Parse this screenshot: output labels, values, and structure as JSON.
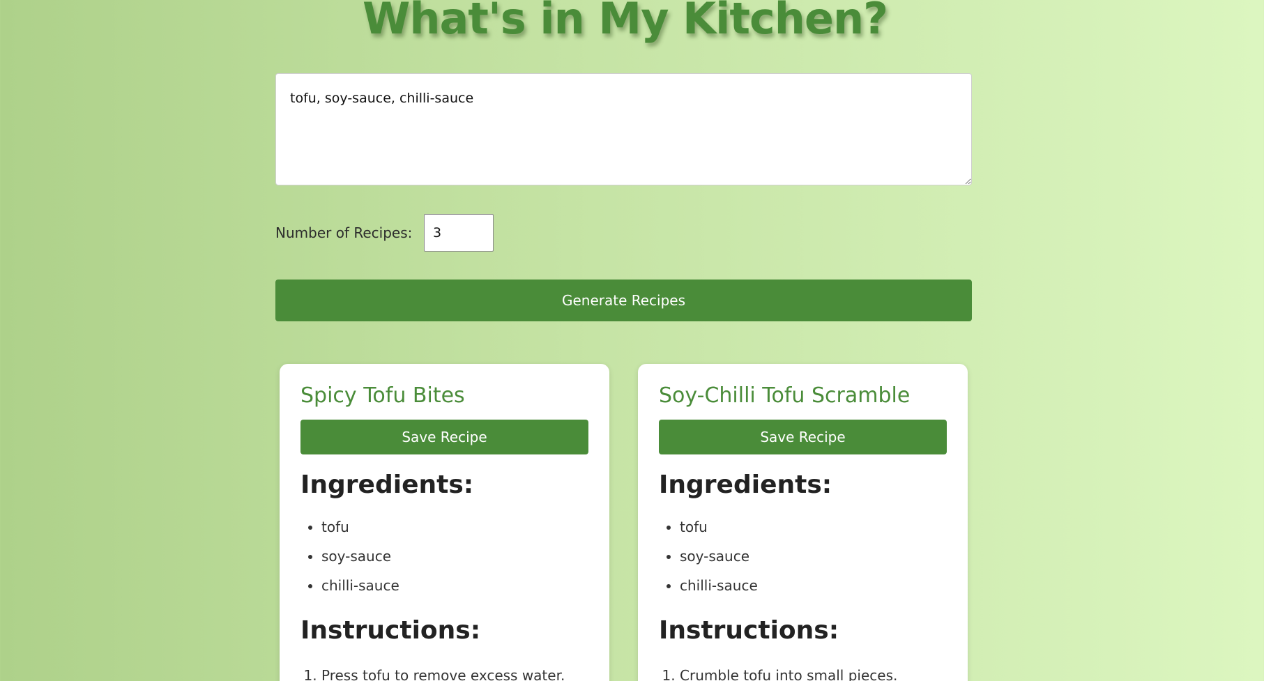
{
  "page": {
    "title": "What's in My Kitchen?"
  },
  "form": {
    "ingredients_value": "tofu, soy-sauce, chilli-sauce",
    "count_label": "Number of Recipes:",
    "count_value": "3",
    "generate_label": "Generate Recipes"
  },
  "recipes": [
    {
      "title": "Spicy Tofu Bites",
      "save_label": "Save Recipe",
      "ingredients_heading": "Ingredients:",
      "ingredients": [
        "tofu",
        "soy-sauce",
        "chilli-sauce"
      ],
      "instructions_heading": "Instructions:",
      "instructions": [
        "Press tofu to remove excess water."
      ]
    },
    {
      "title": "Soy-Chilli Tofu Scramble",
      "save_label": "Save Recipe",
      "ingredients_heading": "Ingredients:",
      "ingredients": [
        "tofu",
        "soy-sauce",
        "chilli-sauce"
      ],
      "instructions_heading": "Instructions:",
      "instructions": [
        "Crumble tofu into small pieces."
      ]
    }
  ],
  "colors": {
    "accent": "#4a8c39",
    "background_left": "#aed18a",
    "background_right": "#dcf6c0"
  }
}
